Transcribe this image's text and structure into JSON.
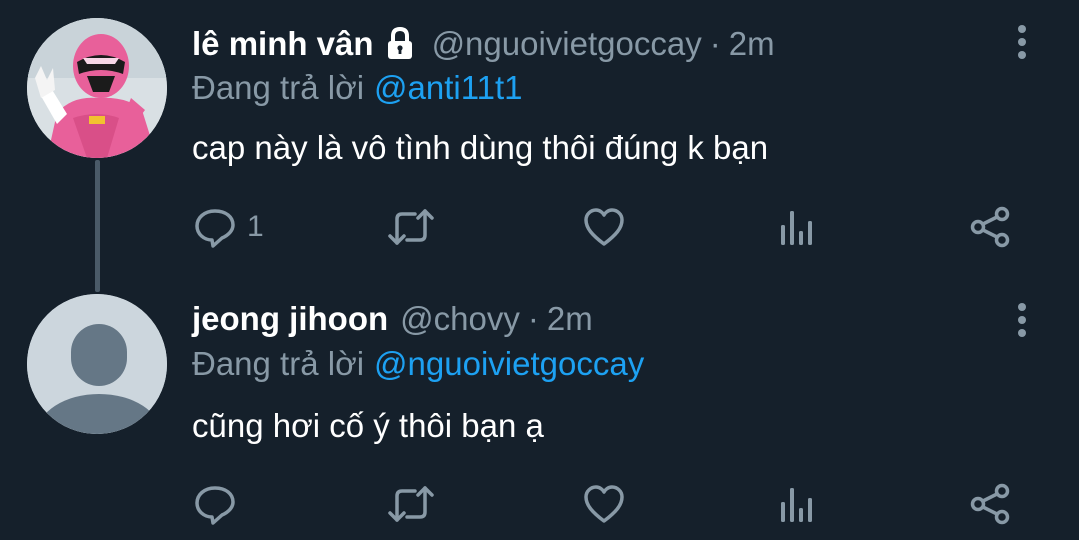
{
  "tweets": [
    {
      "author_name": "lê minh vân",
      "handle": "@nguoivietgoccay",
      "separator": "·",
      "time": "2m",
      "reply_prefix": "Đang trả lời",
      "reply_target": "@anti11t1",
      "text": "cap này là vô tình dùng thôi đúng k bạn",
      "reply_count": "1",
      "icons": [
        "lock-icon",
        "reply-icon",
        "retweet-icon",
        "like-icon",
        "analytics-icon",
        "share-icon",
        "more-icon"
      ]
    },
    {
      "author_name": "jeong jihoon",
      "handle": "@chovy",
      "separator": "·",
      "time": "2m",
      "reply_prefix": "Đang trả lời",
      "reply_target": "@nguoivietgoccay",
      "text": "cũng hơi cố ý thôi bạn ạ",
      "reply_count": "",
      "icons": [
        "reply-icon",
        "retweet-icon",
        "like-icon",
        "analytics-icon",
        "share-icon",
        "more-icon"
      ]
    }
  ],
  "colors": {
    "background": "#15202b",
    "primary_text": "#ffffff",
    "secondary_text": "#8899a6",
    "link": "#1da1f2",
    "thread_line": "#4a5a68",
    "pink_suit": "#e8609a",
    "default_avatar_bg": "#ccd6dd",
    "default_avatar_silhouette": "#657786"
  }
}
